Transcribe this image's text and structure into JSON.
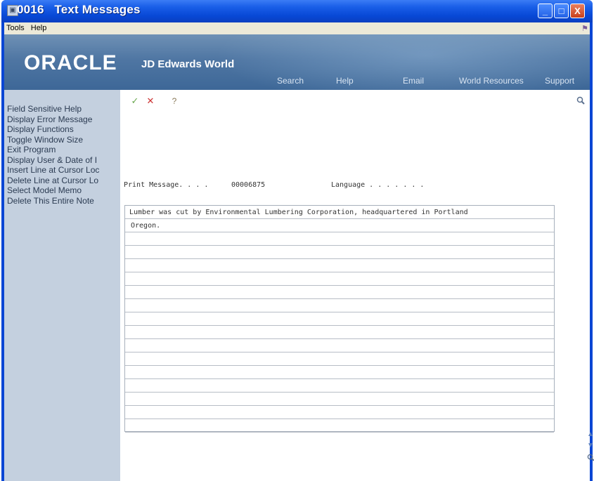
{
  "window": {
    "title": "0016   Text Messages",
    "minimize_label": "_",
    "maximize_label": "□",
    "close_label": "X"
  },
  "menubar": {
    "items": [
      "Tools",
      "Help"
    ]
  },
  "banner": {
    "logo": "ORACLE",
    "product": "JD Edwards World",
    "nav": [
      "Search",
      "Help",
      "Email",
      "World Resources",
      "Support"
    ]
  },
  "functions": [
    "Field Sensitive Help",
    "Display Error Message",
    "Display Functions",
    "Toggle Window Size",
    "Exit Program",
    "Display User & Date of I",
    "Insert Line at Cursor Loc",
    "Delete Line at Cursor Lo",
    "Select Model Memo",
    "Delete This Entire Note"
  ],
  "toolbar": {
    "ok_icon": "✓",
    "cancel_icon": "✕",
    "help_icon": "?"
  },
  "form": {
    "print_message_label": "Print Message. . . .",
    "print_message_value": "00006875",
    "language_label": "Language . . . . . . ."
  },
  "notes": {
    "lines": [
      "Lumber was cut by Environmental Lumbering Corporation, headquartered in Portland",
      "Oregon.",
      "",
      "",
      "",
      "",
      "",
      "",
      "",
      "",
      "",
      "",
      "",
      "",
      "",
      "",
      ""
    ]
  }
}
